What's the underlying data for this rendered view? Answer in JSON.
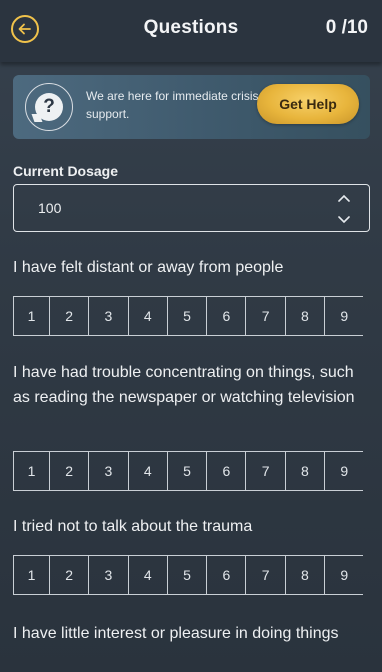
{
  "header": {
    "title": "Questions",
    "counter": "0 /10"
  },
  "banner": {
    "message": "We are here for immediate crisis support.",
    "button_label": "Get Help"
  },
  "dosage": {
    "label": "Current Dosage",
    "value": "100"
  },
  "scale_values": [
    "1",
    "2",
    "3",
    "4",
    "5",
    "6",
    "7",
    "8",
    "9"
  ],
  "questions": [
    {
      "text": "I have felt distant or away from people"
    },
    {
      "text": "I have had trouble concentrating on things, such as reading the newspaper or watching television"
    },
    {
      "text": "I tried not to talk about the trauma"
    },
    {
      "text": "I have little interest or pleasure in doing things"
    }
  ]
}
